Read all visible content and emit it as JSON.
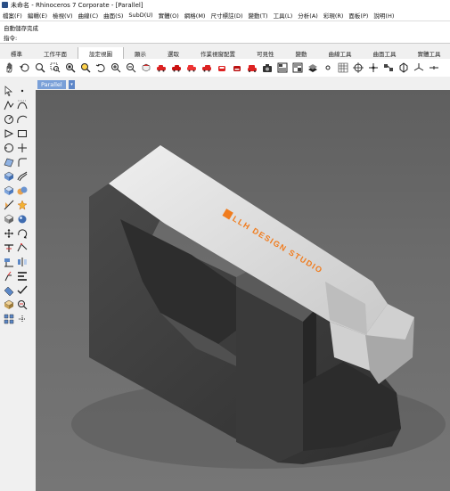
{
  "window": {
    "title": "未命名 - Rhinoceros 7 Corporate - [Parallel]"
  },
  "menu": [
    "檔案(F)",
    "編輯(E)",
    "檢視(V)",
    "曲線(C)",
    "曲面(S)",
    "SubD(U)",
    "實體(O)",
    "網格(M)",
    "尺寸標註(D)",
    "變動(T)",
    "工具(L)",
    "分析(A)",
    "彩現(R)",
    "面板(P)",
    "說明(H)"
  ],
  "command": {
    "history": "自動儲存完成",
    "prompt": "指令:",
    "value": ""
  },
  "tabs": [
    "標準",
    "工作平面",
    "設定視圖",
    "顯示",
    "選取",
    "作業視窗配置",
    "可見性",
    "變動",
    "曲線工具",
    "曲面工具",
    "實體工具"
  ],
  "active_tab": "設定視圖",
  "viewport": {
    "name": "Parallel",
    "dropdown": "▾",
    "model_text": "LLH DESIGN STUDIO",
    "accent_color": "#f07c1e"
  },
  "colors": {
    "viewport_bg": "#6b6b6b",
    "model_dark": "#3c3c3c",
    "model_top": "#d9d9d9",
    "ui_bg": "#f0f0f0"
  }
}
